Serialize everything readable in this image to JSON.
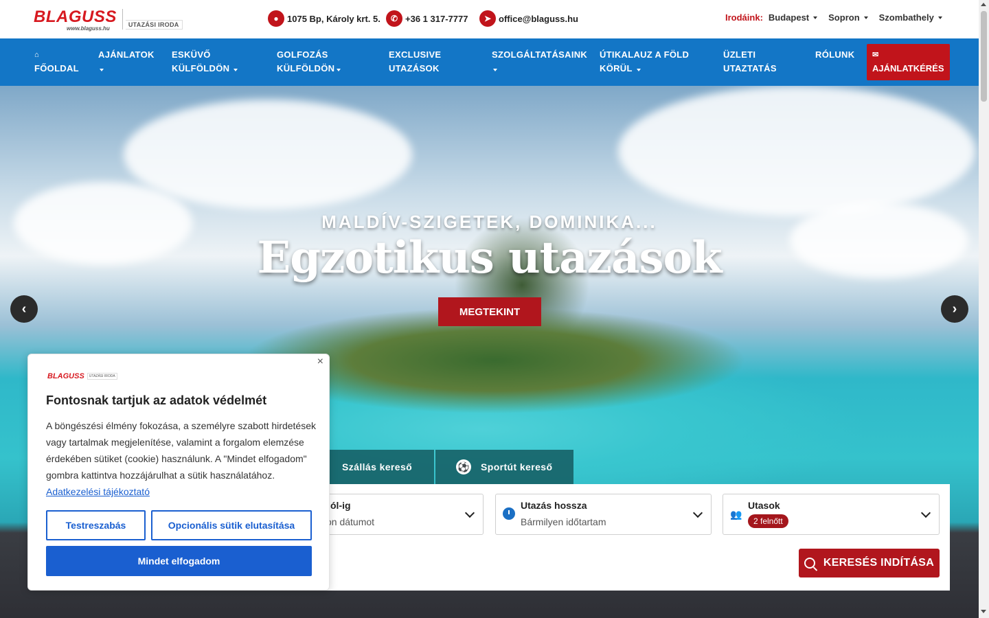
{
  "header": {
    "logo": {
      "brand": "BLAGUSS",
      "url": "www.blaguss.hu",
      "subtitle": "UTAZÁSI IRODA"
    },
    "contacts": {
      "address": "1075 Bp, Károly krt. 5.",
      "phone": "+36 1 317-7777",
      "email": "office@blaguss.hu"
    },
    "offices": {
      "label": "Irodáink:",
      "items": [
        "Budapest",
        "Sopron",
        "Szombathely"
      ]
    }
  },
  "nav": {
    "items": [
      {
        "label": "FŐOLDAL",
        "icon": "home-icon"
      },
      {
        "label": "AJÁNLATOK",
        "dropdown": true
      },
      {
        "label": "ESKÜVŐ",
        "label2": "KÜLFÖLDÖN",
        "dropdown": true
      },
      {
        "label": "GOLFOZÁS",
        "label2": "KÜLFÖLDÖN",
        "dropdown": true
      },
      {
        "label": "EXCLUSIVE",
        "label2": "UTAZÁSOK"
      },
      {
        "label": "SZOLGÁLTATÁSAINK",
        "dropdown": true
      },
      {
        "label": "ÚTIKALAUZ A FÖLD",
        "label2": "KÖRÜL",
        "dropdown": true
      },
      {
        "label": "ÜZLETI",
        "label2": "UTAZTATÁS"
      },
      {
        "label": "RÓLUNK"
      }
    ],
    "cta": {
      "label": "AJÁNLATKÉRÉS",
      "icon": "envelope-icon"
    }
  },
  "hero": {
    "subtitle": "MALDÍV-SZIGETEK, DOMINIKA...",
    "title": "Egzotikus utazások",
    "button": "MEGTEKINT",
    "prev": "‹",
    "next": "›"
  },
  "search": {
    "tabs": [
      {
        "label": "Szállás kereső"
      },
      {
        "label": "Sportút kereső",
        "icon": "soccer-ball-icon"
      }
    ],
    "date": {
      "label": "ól-ig",
      "value": "on dátumot"
    },
    "duration": {
      "label": "Utazás hossza",
      "value": "Bármilyen időtartam"
    },
    "passengers": {
      "label": "Utasok",
      "badge": "2 felnőtt"
    },
    "submit": "KERESÉS INDÍTÁSA"
  },
  "cookie": {
    "logo": {
      "brand": "BLAGUSS",
      "subtitle": "UTAZÁSI IRODA"
    },
    "title": "Fontosnak tartjuk az adatok védelmét",
    "text": "A böngészési élmény fokozása, a személyre szabott hirdetések vagy tartalmak megjelenítése, valamint a forgalom elemzése érdekében sütiket (cookie) használunk. A \"Mindet elfogadom\" gombra kattintva hozzájárulhat a sütik használatához.",
    "link": "Adatkezelési tájékoztató",
    "customize": "Testreszabás",
    "reject": "Opcionális sütik elutasítása",
    "accept": "Mindet elfogadom",
    "close": "×"
  },
  "colors": {
    "brand_red": "#c1141b",
    "nav_blue": "#1376c6",
    "cookie_blue": "#1a5fd0"
  }
}
